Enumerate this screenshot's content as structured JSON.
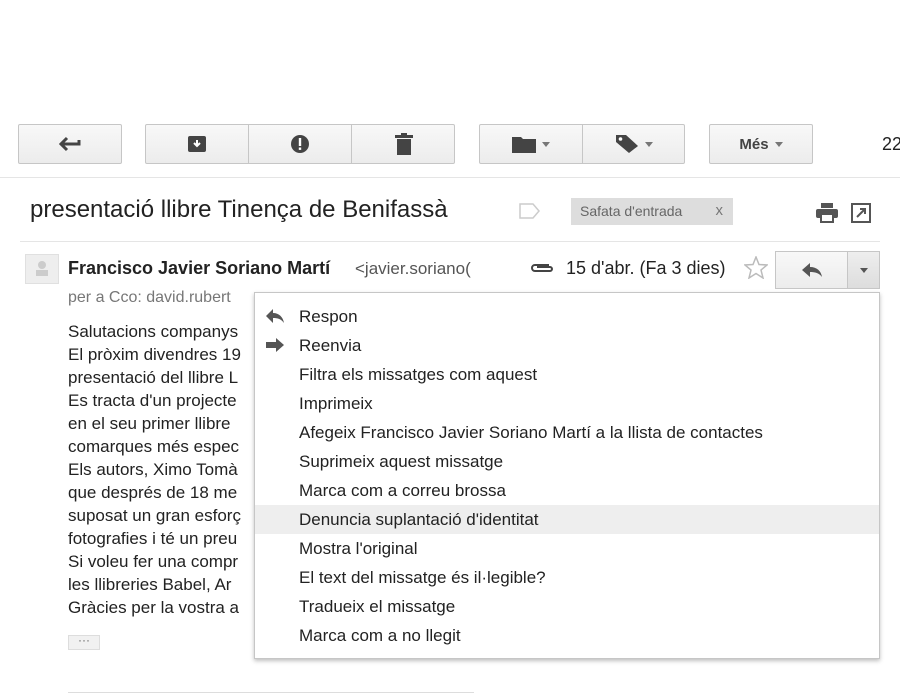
{
  "toolbar": {
    "more_label": "Més",
    "count_partial": "22"
  },
  "message": {
    "subject": "presentació llibre Tinença de Benifassà",
    "label": "Safata d'entrada",
    "label_close": "x",
    "sender_name": "Francisco Javier Soriano Martí",
    "sender_email": "<javier.soriano(",
    "date": "15 d'abr. (Fa 3 dies)",
    "recipients": "per a Cco: david.rubert",
    "body_lines": [
      "Salutacions companys",
      "El pròxim divendres 19",
      "presentació del llibre L",
      "Es tracta d'un projecte",
      "en el seu primer llibre",
      "comarques més espec",
      "Els autors, Ximo Tomà",
      "que després de 18 me",
      "suposat un gran esforç",
      "fotografies i té un preu",
      "Si voleu fer una compr",
      "les llibreries Babel, Ar",
      "Gràcies per la vostra a"
    ],
    "ellipsis": "···"
  },
  "menu": {
    "items": [
      {
        "label": "Respon",
        "icon": "reply-icon"
      },
      {
        "label": "Reenvia",
        "icon": "forward-icon"
      },
      {
        "label": "Filtra els missatges com aquest"
      },
      {
        "label": "Imprimeix"
      },
      {
        "label": "Afegeix Francisco Javier Soriano Martí a la llista de contactes"
      },
      {
        "label": "Suprimeix aquest missatge"
      },
      {
        "label": "Marca com a correu brossa"
      },
      {
        "label": "Denuncia suplantació d'identitat",
        "highlighted": true
      },
      {
        "label": "Mostra l'original"
      },
      {
        "label": "El text del missatge és il·legible?"
      },
      {
        "label": "Tradueix el missatge"
      },
      {
        "label": "Marca com a no llegit"
      }
    ]
  }
}
